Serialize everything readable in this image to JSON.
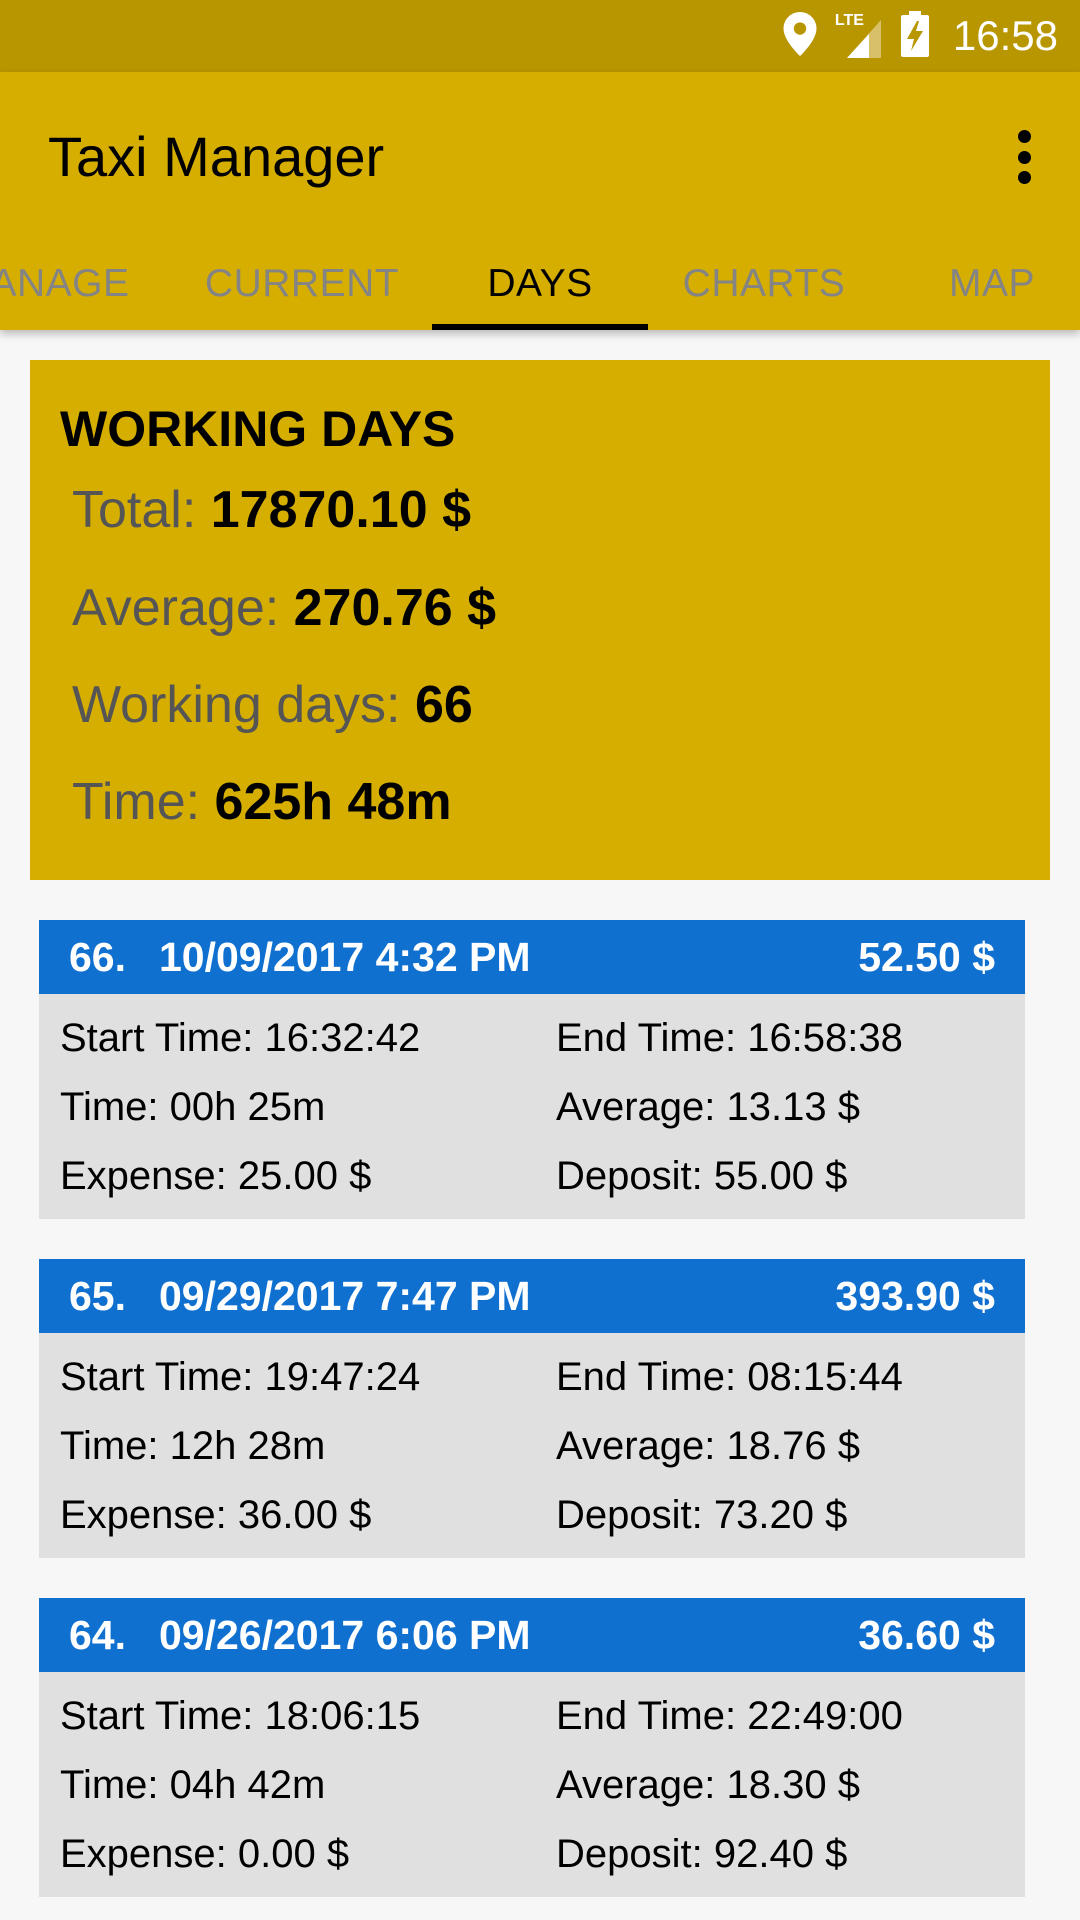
{
  "status_bar": {
    "time": "16:58",
    "icons": [
      "location-icon",
      "lte-signal-icon",
      "battery-charging-icon"
    ],
    "network_label": "LTE"
  },
  "app_bar": {
    "title": "Taxi Manager",
    "overflow_icon": "more-vert-icon"
  },
  "tabs": [
    {
      "label": "ANAGE",
      "active": false
    },
    {
      "label": "CURRENT",
      "active": false
    },
    {
      "label": "DAYS",
      "active": true
    },
    {
      "label": "CHARTS",
      "active": false
    },
    {
      "label": "MAP",
      "active": false
    }
  ],
  "summary": {
    "title": "WORKING DAYS",
    "total_label": "Total:",
    "total_value": "17870.10 $",
    "average_label": "Average:",
    "average_value": "270.76 $",
    "days_label": "Working days:",
    "days_value": "66",
    "time_label": "Time:",
    "time_value": "625h 48m"
  },
  "days": [
    {
      "number": "66.",
      "datetime": "10/09/2017 4:32 PM",
      "total": "52.50 $",
      "start_time": "Start Time: 16:32:42",
      "end_time": "End Time: 16:58:38",
      "time": "Time: 00h 25m",
      "average": "Average: 13.13 $",
      "expense": "Expense: 25.00 $",
      "deposit": "Deposit: 55.00 $"
    },
    {
      "number": "65.",
      "datetime": "09/29/2017 7:47 PM",
      "total": "393.90 $",
      "start_time": "Start Time: 19:47:24",
      "end_time": "End Time: 08:15:44",
      "time": "Time: 12h 28m",
      "average": "Average: 18.76 $",
      "expense": "Expense: 36.00 $",
      "deposit": "Deposit: 73.20 $"
    },
    {
      "number": "64.",
      "datetime": "09/26/2017 6:06 PM",
      "total": "36.60 $",
      "start_time": "Start Time: 18:06:15",
      "end_time": "End Time: 22:49:00",
      "time": "Time: 04h 42m",
      "average": "Average: 18.30 $",
      "expense": "Expense: 0.00 $",
      "deposit": "Deposit: 92.40 $"
    }
  ],
  "colors": {
    "status_bar": "#b89600",
    "primary": "#d6ae00",
    "day_header": "#1070d0",
    "day_body": "#e0e0e0",
    "tab_inactive": "#848484"
  }
}
